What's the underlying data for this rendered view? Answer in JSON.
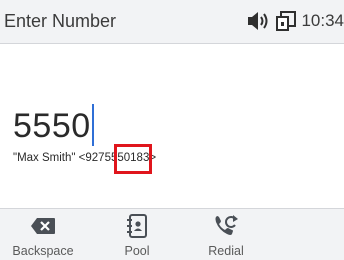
{
  "header": {
    "title": "Enter Number",
    "time": "10:34",
    "volume_icon": "speaker-volume-icon",
    "device_icon": "screen-link-icon"
  },
  "dial": {
    "number": "5550",
    "suggestion": "\"Max Smith\" <9275550183>"
  },
  "softkeys": [
    {
      "label": "Backspace",
      "icon": "backspace-icon"
    },
    {
      "label": "Pool",
      "icon": "directory-card-icon"
    },
    {
      "label": "Redial",
      "icon": "redial-phone-icon"
    }
  ],
  "colors": {
    "accent": "#2f6fd6",
    "highlight": "#e0151c",
    "bar": "#f2f3f5"
  }
}
